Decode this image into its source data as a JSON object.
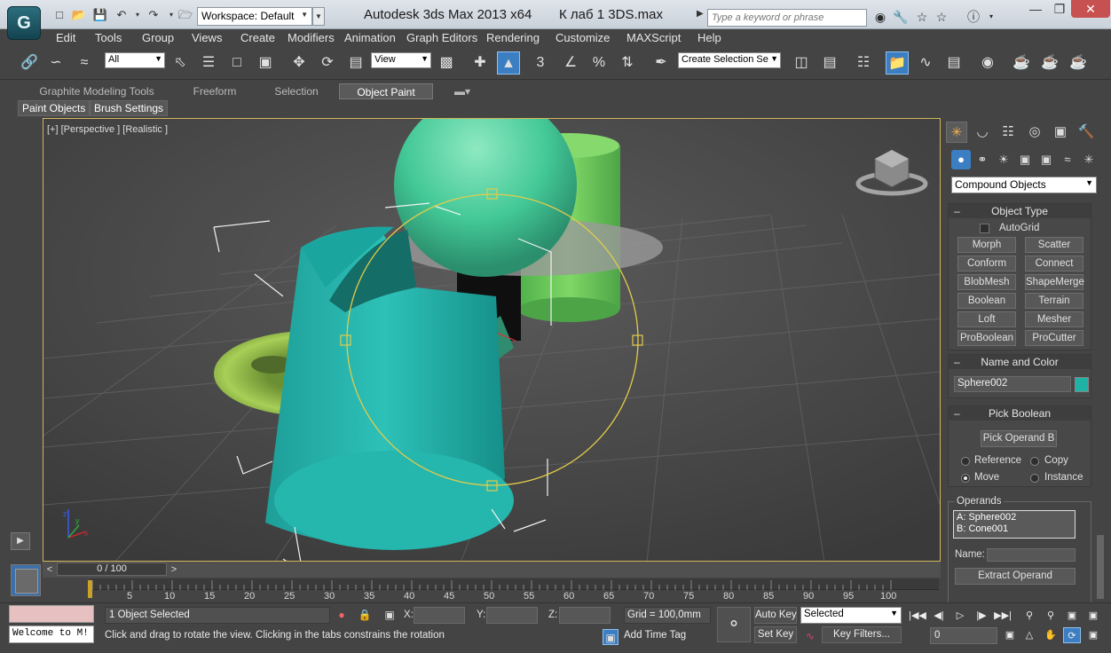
{
  "titlebar": {
    "workspace": "Workspace: Default",
    "app_title": "Autodesk 3ds Max  2013 x64",
    "file_title": "К лаб 1 3DS.max",
    "search_placeholder": "Type a keyword or phrase"
  },
  "menu": [
    "Edit",
    "Tools",
    "Group",
    "Views",
    "Create",
    "Modifiers",
    "Animation",
    "Graph Editors",
    "Rendering",
    "Customize",
    "MAXScript",
    "Help"
  ],
  "toolbar": {
    "filter_value": "All",
    "refcoord_value": "View",
    "named_selection_value": "Create Selection Se",
    "snap_label": "3"
  },
  "ribbon": {
    "tabs": [
      "Graphite Modeling Tools",
      "Freeform",
      "Selection",
      "Object Paint"
    ],
    "subtabs": [
      "Paint Objects",
      "Brush Settings"
    ]
  },
  "viewport": {
    "label": "[+] [Perspective ] [Realistic ]"
  },
  "command_panel": {
    "category_value": "Compound Objects",
    "object_type": {
      "title": "Object Type",
      "autogrid_label": "AutoGrid",
      "buttons": [
        "Morph",
        "Scatter",
        "Conform",
        "Connect",
        "BlobMesh",
        "ShapeMerge",
        "Boolean",
        "Terrain",
        "Loft",
        "Mesher",
        "ProBoolean",
        "ProCutter"
      ]
    },
    "name_color": {
      "title": "Name and Color",
      "name_value": "Sphere002",
      "swatch_color": "#1fb3a6"
    },
    "pick_boolean": {
      "title": "Pick Boolean",
      "pick_button": "Pick Operand B",
      "radio_reference": "Reference",
      "radio_copy": "Copy",
      "radio_move": "Move",
      "radio_instance": "Instance"
    },
    "operands": {
      "title": "Operands",
      "items": [
        "A: Sphere002",
        "B: Cone001"
      ],
      "name_label": "Name:",
      "extract_button": "Extract Operand"
    }
  },
  "timeslider": {
    "position": "0 / 100",
    "ticks": [
      "5",
      "10",
      "15",
      "20",
      "25",
      "30",
      "35",
      "40",
      "45",
      "50",
      "55",
      "60",
      "65",
      "70",
      "75",
      "80",
      "85",
      "90",
      "95",
      "100"
    ]
  },
  "status": {
    "listener_text": "Welcome to M!",
    "selection": "1 Object Selected",
    "prompt": "Click and drag to rotate the view.  Clicking in the tabs constrains the rotation",
    "x_label": "X:",
    "y_label": "Y:",
    "z_label": "Z:",
    "grid": "Grid = 100,0mm",
    "add_time_tag": "Add Time Tag",
    "auto_key": "Auto Key",
    "set_key": "Set Key",
    "key_mode_value": "Selected",
    "key_filters": "Key Filters...",
    "frame_value": "0"
  }
}
